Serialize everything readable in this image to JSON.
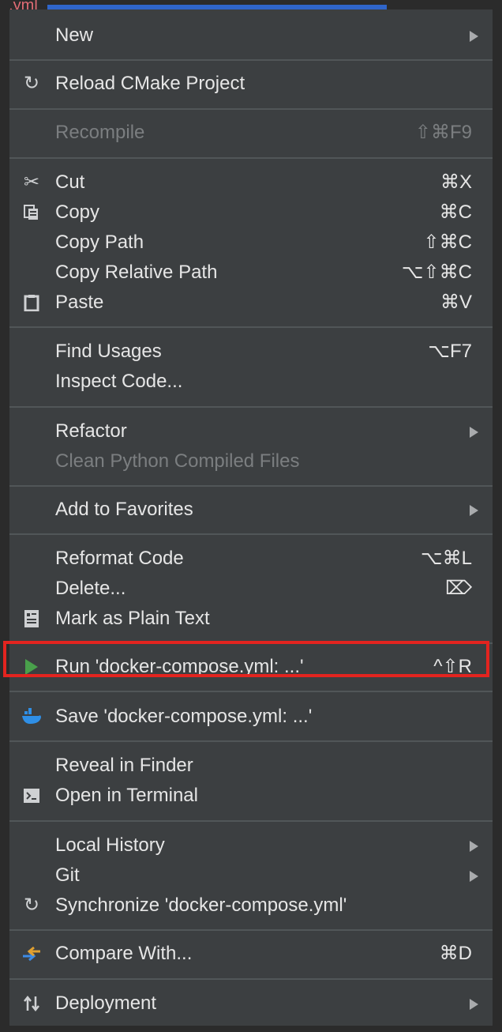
{
  "background": {
    "tab_label": "e.yml"
  },
  "menu": {
    "items": [
      {
        "label": "New",
        "shortcut": "",
        "submenu": true
      },
      {
        "label": "Reload CMake Project",
        "shortcut": "",
        "icon": "reload-icon"
      },
      {
        "label": "Recompile",
        "shortcut": "⇧⌘F9",
        "disabled": true
      },
      {
        "label": "Cut",
        "shortcut": "⌘X",
        "icon": "scissors-icon"
      },
      {
        "label": "Copy",
        "shortcut": "⌘C",
        "icon": "copy-icon"
      },
      {
        "label": "Copy Path",
        "shortcut": "⇧⌘C"
      },
      {
        "label": "Copy Relative Path",
        "shortcut": "⌥⇧⌘C"
      },
      {
        "label": "Paste",
        "shortcut": "⌘V",
        "icon": "clipboard-icon"
      },
      {
        "label": "Find Usages",
        "shortcut": "⌥F7"
      },
      {
        "label": "Inspect Code...",
        "shortcut": ""
      },
      {
        "label": "Refactor",
        "shortcut": "",
        "submenu": true
      },
      {
        "label": "Clean Python Compiled Files",
        "shortcut": "",
        "disabled": true
      },
      {
        "label": "Add to Favorites",
        "shortcut": "",
        "submenu": true
      },
      {
        "label": "Reformat Code",
        "shortcut": "⌥⌘L"
      },
      {
        "label": "Delete...",
        "shortcut": "⌦"
      },
      {
        "label": "Mark as Plain Text",
        "shortcut": "",
        "icon": "text-file-icon"
      },
      {
        "label": "Run 'docker-compose.yml: ...'",
        "shortcut": "^⇧R",
        "icon": "run-icon",
        "highlighted": true
      },
      {
        "label": "Save 'docker-compose.yml: ...'",
        "shortcut": "",
        "icon": "docker-icon"
      },
      {
        "label": "Reveal in Finder",
        "shortcut": ""
      },
      {
        "label": "Open in Terminal",
        "shortcut": "",
        "icon": "terminal-icon"
      },
      {
        "label": "Local History",
        "shortcut": "",
        "submenu": true
      },
      {
        "label": "Git",
        "shortcut": "",
        "submenu": true
      },
      {
        "label": "Synchronize 'docker-compose.yml'",
        "shortcut": "",
        "icon": "reload-icon"
      },
      {
        "label": "Compare With...",
        "shortcut": "⌘D",
        "icon": "compare-icon"
      },
      {
        "label": "Deployment",
        "shortcut": "",
        "icon": "deployment-icon",
        "submenu": true
      }
    ]
  },
  "colors": {
    "menu_bg": "#3c3f41",
    "highlight_border": "#e3241f",
    "run_icon": "#49a04b"
  }
}
